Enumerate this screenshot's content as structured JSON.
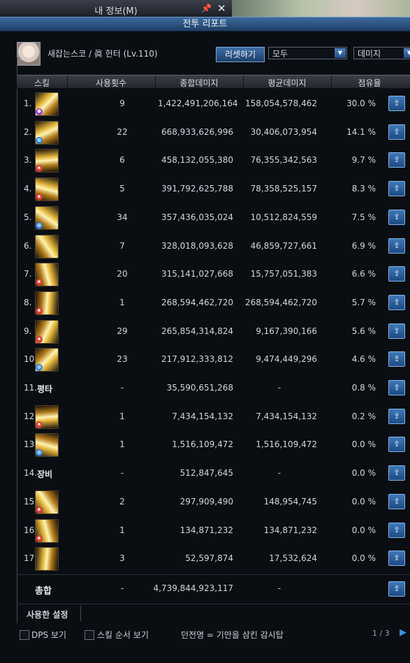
{
  "window": {
    "title": "내 정보(M)",
    "pin_icon": "pin-icon",
    "close_icon": "close-icon"
  },
  "report": {
    "title": "전투 리포트",
    "character": "새잡는스코 / 眞 헌터 (Lv.110)",
    "reset_label": "리셋하기",
    "filter_target": "모두",
    "filter_metric": "데미지"
  },
  "columns": [
    "스킬",
    "사용횟수",
    "종합데미지",
    "평균데미지",
    "점유율"
  ],
  "rows": [
    {
      "n": "1.",
      "count": "9",
      "total": "1,422,491,206,164",
      "avg": "158,054,578,462",
      "share": "30.0 %",
      "badge": "purple"
    },
    {
      "n": "2.",
      "count": "22",
      "total": "668,933,626,996",
      "avg": "30,406,073,954",
      "share": "14.1 %",
      "badge": "blue"
    },
    {
      "n": "3.",
      "count": "6",
      "total": "458,132,055,380",
      "avg": "76,355,342,563",
      "share": "9.7 %",
      "badge": "red"
    },
    {
      "n": "4.",
      "count": "5",
      "total": "391,792,625,788",
      "avg": "78,358,525,157",
      "share": "8.3 %",
      "badge": "red"
    },
    {
      "n": "5.",
      "count": "34",
      "total": "357,436,035,024",
      "avg": "10,512,824,559",
      "share": "7.5 %",
      "badge": "blue"
    },
    {
      "n": "6.",
      "count": "7",
      "total": "328,018,093,628",
      "avg": "46,859,727,661",
      "share": "6.9 %",
      "badge": ""
    },
    {
      "n": "7.",
      "count": "20",
      "total": "315,141,027,668",
      "avg": "15,757,051,383",
      "share": "6.6 %",
      "badge": "red"
    },
    {
      "n": "8.",
      "count": "1",
      "total": "268,594,462,720",
      "avg": "268,594,462,720",
      "share": "5.7 %",
      "badge": "red"
    },
    {
      "n": "9.",
      "count": "29",
      "total": "265,854,314,824",
      "avg": "9,167,390,166",
      "share": "5.6 %",
      "badge": "red"
    },
    {
      "n": "10.",
      "count": "23",
      "total": "217,912,333,812",
      "avg": "9,474,449,296",
      "share": "4.6 %",
      "badge": "blue"
    },
    {
      "n": "11.",
      "label": "평타",
      "count": "-",
      "total": "35,590,651,268",
      "avg": "-",
      "share": "0.8 %",
      "badge": ""
    },
    {
      "n": "12.",
      "count": "1",
      "total": "7,434,154,132",
      "avg": "7,434,154,132",
      "share": "0.2 %",
      "badge": "red"
    },
    {
      "n": "13.",
      "count": "1",
      "total": "1,516,109,472",
      "avg": "1,516,109,472",
      "share": "0.0 %",
      "badge": "blue"
    },
    {
      "n": "14.",
      "label": "장비",
      "count": "-",
      "total": "512,847,645",
      "avg": "-",
      "share": "0.0 %",
      "badge": ""
    },
    {
      "n": "15.",
      "count": "2",
      "total": "297,909,490",
      "avg": "148,954,745",
      "share": "0.0 %",
      "badge": "red"
    },
    {
      "n": "16.",
      "count": "1",
      "total": "134,871,232",
      "avg": "134,871,232",
      "share": "0.0 %",
      "badge": "red"
    },
    {
      "n": "17.",
      "count": "3",
      "total": "52,597,874",
      "avg": "17,532,624",
      "share": "0.0 %",
      "badge": ""
    }
  ],
  "total": {
    "label": "총합",
    "count": "-",
    "total": "4,739,844,923,117",
    "avg": "-"
  },
  "used_settings_label": "사용한 설정",
  "bottom": {
    "dps_label": "DPS 보기",
    "skill_order_label": "스킬 순서 보기",
    "dungeon_text": "던전명 = 기만을 삼킨 감시탑",
    "page": "1 / 3"
  },
  "colors": {
    "header_blue": "#2f5c90",
    "button_blue": "#2a5b95",
    "badge_red": "#d63a2f",
    "badge_blue": "#2d7ed8",
    "badge_purple": "#8b3fd1",
    "icon_gold": "#e2b43b"
  }
}
